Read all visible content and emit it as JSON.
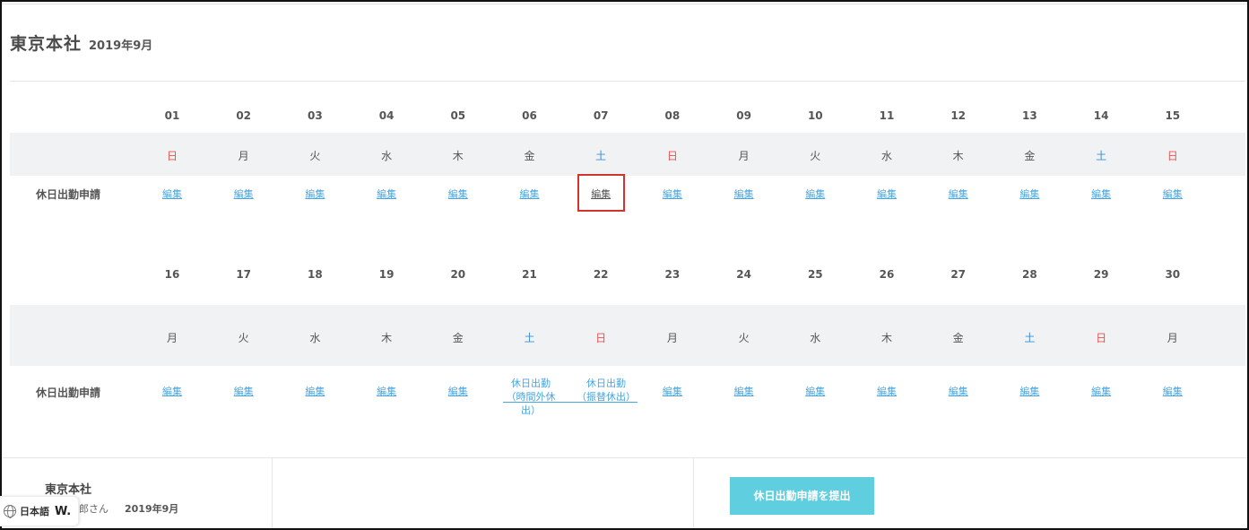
{
  "header": {
    "title": "東京本社",
    "month": "2019年9月"
  },
  "row_label": "休日出勤申請",
  "edit_label": "編集",
  "week1": {
    "days": [
      "01",
      "02",
      "03",
      "04",
      "05",
      "06",
      "07",
      "08",
      "09",
      "10",
      "11",
      "12",
      "13",
      "14",
      "15"
    ],
    "dows": [
      "日",
      "月",
      "火",
      "水",
      "木",
      "金",
      "土",
      "日",
      "月",
      "火",
      "水",
      "木",
      "金",
      "土",
      "日"
    ]
  },
  "week2": {
    "days": [
      "16",
      "17",
      "18",
      "19",
      "20",
      "21",
      "22",
      "23",
      "24",
      "25",
      "26",
      "27",
      "28",
      "29",
      "30"
    ],
    "dows": [
      "月",
      "火",
      "水",
      "木",
      "金",
      "土",
      "日",
      "月",
      "火",
      "水",
      "木",
      "金",
      "土",
      "日",
      "月"
    ]
  },
  "holiday_requests": {
    "d21": {
      "line1": "休日出勤",
      "line2": "（時間外休出）"
    },
    "d22": {
      "line1": "休日出勤",
      "line2": "（振替休出）"
    }
  },
  "footer": {
    "title": "東京本社",
    "user": "郎さん",
    "month": "2019年9月",
    "submit_label": "休日出勤申請を提出"
  },
  "language": {
    "label": "日本語",
    "logo": "W."
  },
  "colors": {
    "sunday": "#e8534f",
    "saturday": "#3d8fd6",
    "link": "#4aa6dc",
    "submit_button": "#5fcfe0",
    "highlight": "#d0342c"
  }
}
